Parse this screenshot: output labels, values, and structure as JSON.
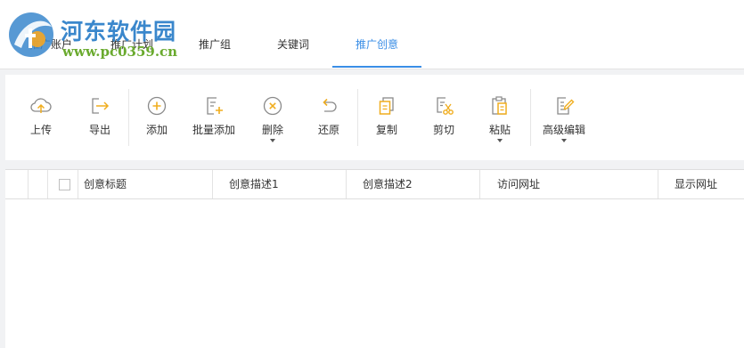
{
  "watermark": {
    "title": "河东软件园",
    "url": "www.pc0359.cn"
  },
  "tabs": [
    {
      "label": "推广账户"
    },
    {
      "label": "推广计划"
    },
    {
      "label": "推广组"
    },
    {
      "label": "关键词"
    },
    {
      "label": "推广创意",
      "active": true
    }
  ],
  "toolbar": {
    "upload": "上传",
    "export": "导出",
    "add": "添加",
    "bulk_add": "批量添加",
    "delete": "删除",
    "restore": "还原",
    "copy": "复制",
    "cut": "剪切",
    "paste": "粘贴",
    "advanced_edit": "高级编辑"
  },
  "table": {
    "columns": [
      "创意标题",
      "创意描述1",
      "创意描述2",
      "访问网址",
      "显示网址"
    ],
    "rows": []
  },
  "colors": {
    "accent": "#3a8ee6",
    "icon_gray": "#8a8a8a",
    "icon_yellow": "#f0ad1e",
    "watermark_blue": "#3a87cc",
    "watermark_green": "#6aaa2e"
  }
}
